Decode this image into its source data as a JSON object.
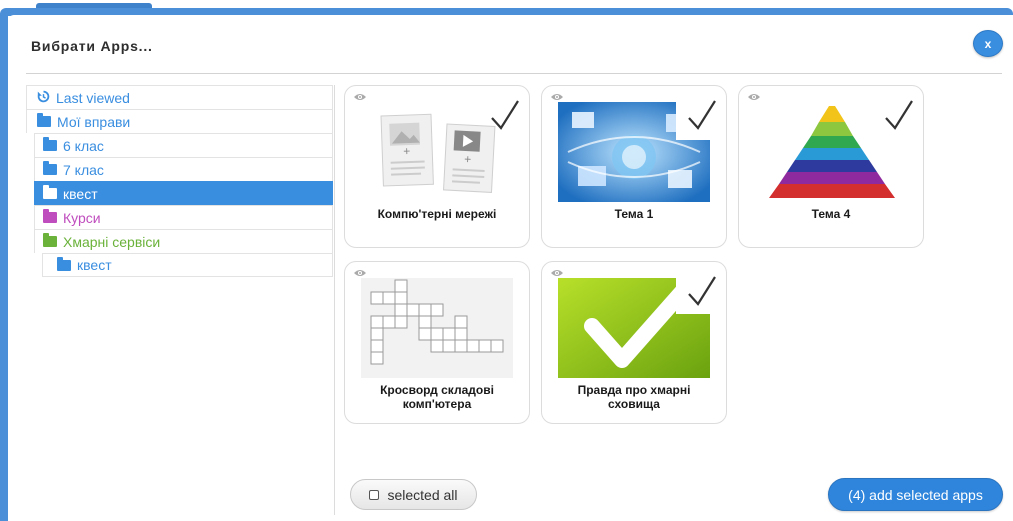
{
  "dialog": {
    "title": "Вибрати Apps...",
    "close_label": "x"
  },
  "colors": {
    "accent": "#3a8ee0",
    "frame": "#4a8fd8",
    "folder_blue": "#3a8ee0",
    "folder_pink": "#c04dbe",
    "folder_green": "#6ab23a"
  },
  "sidebar": {
    "items": [
      {
        "label": "Last viewed",
        "icon": "history-icon",
        "color": "#3a8ee0"
      },
      {
        "label": "Мої вправи",
        "icon": "folder-icon",
        "color": "#3a8ee0"
      },
      {
        "label": "6 клас",
        "icon": "folder-icon",
        "color": "#3a8ee0"
      },
      {
        "label": "7 клас",
        "icon": "folder-icon",
        "color": "#3a8ee0"
      },
      {
        "label": "квест",
        "icon": "folder-icon",
        "color": "#ffffff",
        "selected": true
      },
      {
        "label": "Курси",
        "icon": "folder-icon",
        "color": "#c04dbe"
      },
      {
        "label": "Хмарні сервіси",
        "icon": "folder-icon",
        "color": "#6ab23a"
      },
      {
        "label": "квест",
        "icon": "folder-icon",
        "color": "#3a8ee0"
      }
    ]
  },
  "apps": [
    {
      "label": "Компю'терні мережі",
      "thumb": "placeholder-media-icon",
      "selected": true
    },
    {
      "label": "Тема 1",
      "thumb": "network-collage-image",
      "selected": true
    },
    {
      "label": "Тема 4",
      "thumb": "pyramid-image",
      "selected": true
    },
    {
      "label": "Кросворд складові комп'ютера",
      "thumb": "crossword-image",
      "selected": false
    },
    {
      "label": "Правда про хмарні сховища",
      "thumb": "green-check-image",
      "selected": true
    }
  ],
  "footer": {
    "select_all_label": "selected all",
    "add_label": "(4) add selected apps"
  }
}
